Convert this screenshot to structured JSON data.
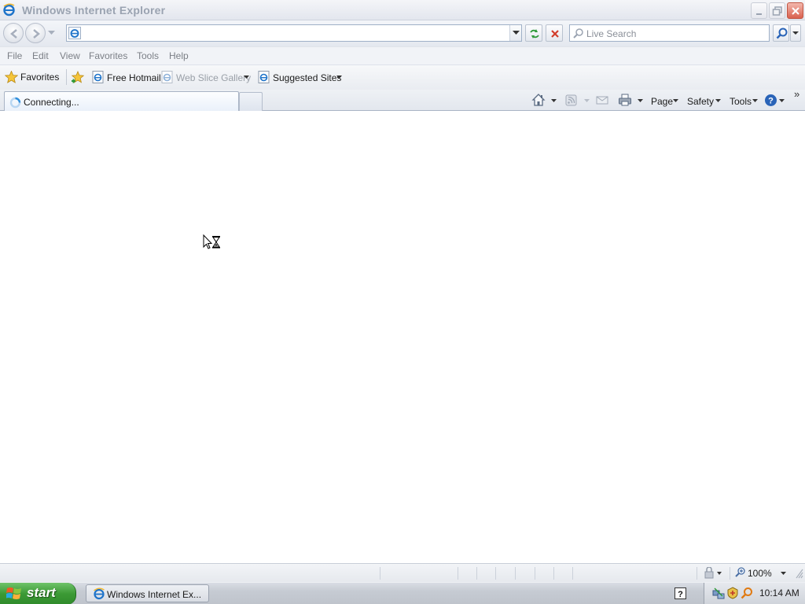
{
  "window": {
    "title": "Windows Internet Explorer"
  },
  "address": {
    "value": "",
    "placeholder": ""
  },
  "search": {
    "placeholder": "Live Search"
  },
  "menu": {
    "items": [
      "File",
      "Edit",
      "View",
      "Favorites",
      "Tools",
      "Help"
    ]
  },
  "favorites": {
    "label": "Favorites",
    "links": [
      {
        "label": "Free Hotmail",
        "enabled": true,
        "has_dropdown": false
      },
      {
        "label": "Web Slice Gallery",
        "enabled": false,
        "has_dropdown": true
      },
      {
        "label": "Suggested Sites",
        "enabled": true,
        "has_dropdown": true
      }
    ]
  },
  "tab": {
    "label": "Connecting..."
  },
  "commandbar": {
    "page": "Page",
    "safety": "Safety",
    "tools": "Tools",
    "icons": [
      "home-icon",
      "feeds-icon",
      "read-mail-icon",
      "print-icon",
      "help-icon"
    ]
  },
  "status": {
    "zoom": "100%"
  },
  "taskbar": {
    "start": "start",
    "task_label": "Windows Internet Ex...",
    "clock": "10:14 AM"
  },
  "colors": {
    "start_green": "#3c9a35",
    "close_red": "#d9614f",
    "ie_blue": "#1e73c9"
  }
}
